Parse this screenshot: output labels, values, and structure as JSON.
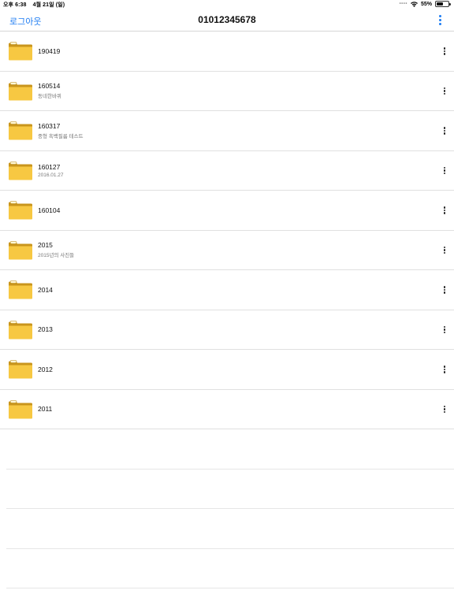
{
  "status_bar": {
    "time": "오후 6:38",
    "date": "4월 21일 (일)",
    "battery": "55%",
    "battery_level": 0.55
  },
  "nav": {
    "logout_label": "로그아웃",
    "title": "01012345678",
    "menu_icon": "more-vertical-icon",
    "accent_color": "#1e7cf2"
  },
  "folders": [
    {
      "name": "190419",
      "subtitle": ""
    },
    {
      "name": "160514",
      "subtitle": "동네한바퀴"
    },
    {
      "name": "160317",
      "subtitle": "중형 흑백필름 테스트"
    },
    {
      "name": "160127",
      "subtitle": "2016.01.27"
    },
    {
      "name": "160104",
      "subtitle": ""
    },
    {
      "name": "2015",
      "subtitle": "2015년의 사진들"
    },
    {
      "name": "2014",
      "subtitle": ""
    },
    {
      "name": "2013",
      "subtitle": ""
    },
    {
      "name": "2012",
      "subtitle": ""
    },
    {
      "name": "2011",
      "subtitle": ""
    }
  ],
  "icons": {
    "folder": "folder-icon",
    "row_menu": "more-vertical-icon",
    "folder_color": "#f7c842"
  }
}
